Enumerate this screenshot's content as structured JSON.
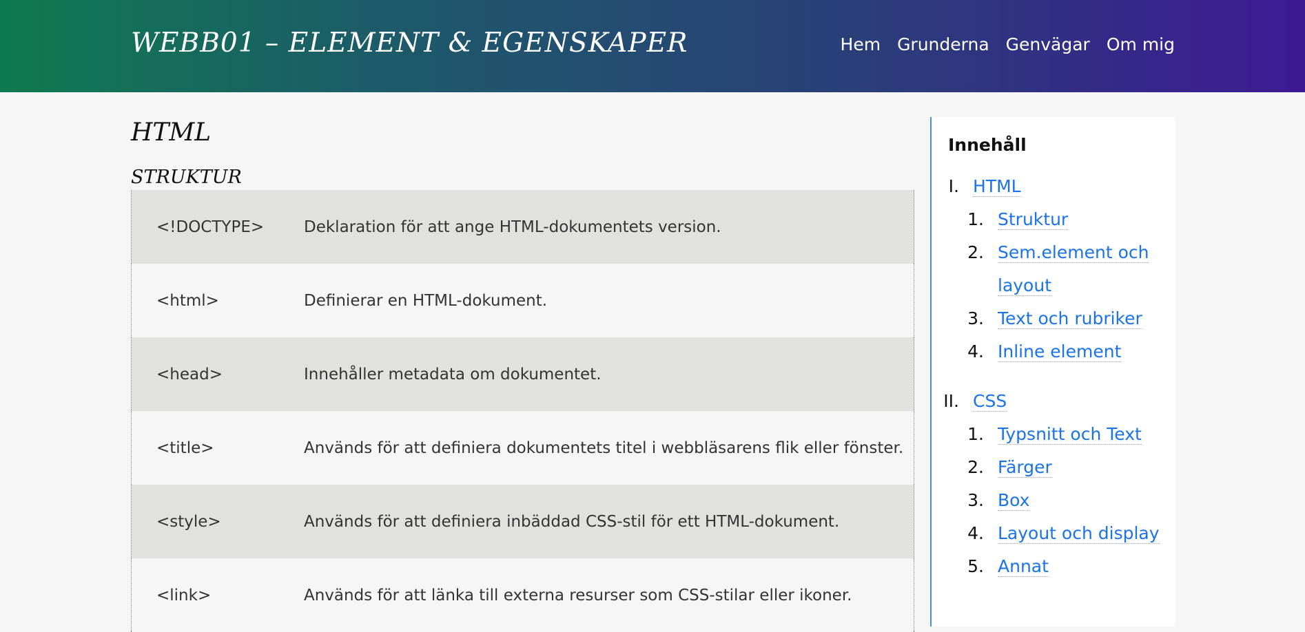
{
  "header": {
    "site_title": "WEBB01 – ELEMENT & EGENSKAPER",
    "nav": [
      "Hem",
      "Grunderna",
      "Genvägar",
      "Om mig"
    ]
  },
  "main": {
    "heading": "HTML",
    "subheading": "STRUKTUR",
    "rows": [
      {
        "tag": "<!DOCTYPE>",
        "desc": "Deklaration för att ange HTML-dokumentets version."
      },
      {
        "tag": "<html>",
        "desc": "Definierar en HTML-dokument."
      },
      {
        "tag": "<head>",
        "desc": "Innehåller metadata om dokumentet."
      },
      {
        "tag": "<title>",
        "desc": "Används för att definiera dokumentets titel i webbläsarens flik eller fönster."
      },
      {
        "tag": "<style>",
        "desc": "Används för att definiera inbäddad CSS-stil för ett HTML-dokument."
      },
      {
        "tag": "<link>",
        "desc": "Används för att länka till externa resurser som CSS-stilar eller ikoner."
      }
    ]
  },
  "sidebar": {
    "title": "Innehåll",
    "sections": [
      {
        "num": "I.",
        "label": "HTML",
        "items": [
          "Struktur",
          "Sem.element och",
          "layout",
          "Text och rubriker",
          "Inline element"
        ]
      },
      {
        "num": "II.",
        "label": "CSS",
        "items": [
          "Typsnitt och Text",
          "Färger",
          "Box",
          "Layout och display",
          "Annat"
        ]
      }
    ]
  },
  "colors": {
    "link": "#1a73e8",
    "header_start": "#0f7a4f",
    "header_end": "#3c1a93",
    "row_alt": "#e1e2df"
  }
}
